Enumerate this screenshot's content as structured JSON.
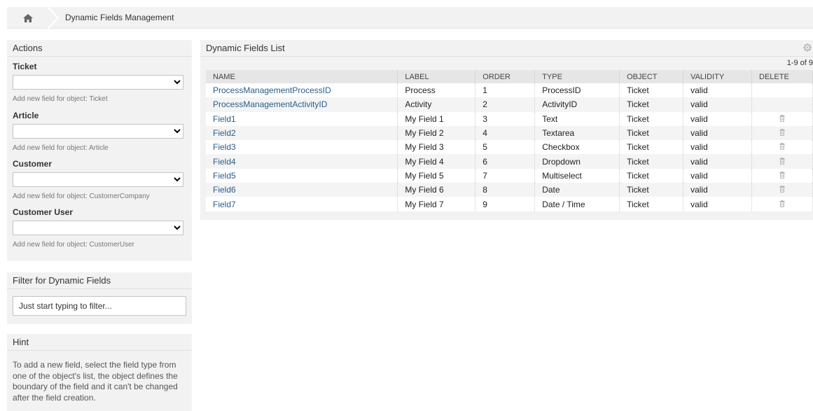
{
  "breadcrumb": {
    "home_icon": "home-icon",
    "title": "Dynamic Fields Management"
  },
  "actions": {
    "title": "Actions",
    "groups": [
      {
        "title": "Ticket",
        "hint": "Add new field for object: Ticket"
      },
      {
        "title": "Article",
        "hint": "Add new field for object: Article"
      },
      {
        "title": "Customer",
        "hint": "Add new field for object: CustomerCompany"
      },
      {
        "title": "Customer User",
        "hint": "Add new field for object: CustomerUser"
      }
    ]
  },
  "filter": {
    "title": "Filter for Dynamic Fields",
    "placeholder": "Just start typing to filter..."
  },
  "hint": {
    "title": "Hint",
    "text": "To add a new field, select the field type from one of the object's list, the object defines the boundary of the field and it can't be changed after the field creation."
  },
  "list": {
    "title": "Dynamic Fields List",
    "pager": "1-9 of 9",
    "settings_icon": "gear-icon",
    "columns": [
      "NAME",
      "LABEL",
      "ORDER",
      "TYPE",
      "OBJECT",
      "VALIDITY",
      "DELETE"
    ],
    "rows": [
      {
        "name": "ProcessManagementProcessID",
        "label": "Process",
        "order": "1",
        "type": "ProcessID",
        "object": "Ticket",
        "validity": "valid",
        "deletable": false
      },
      {
        "name": "ProcessManagementActivityID",
        "label": "Activity",
        "order": "2",
        "type": "ActivityID",
        "object": "Ticket",
        "validity": "valid",
        "deletable": false
      },
      {
        "name": "Field1",
        "label": "My Field 1",
        "order": "3",
        "type": "Text",
        "object": "Ticket",
        "validity": "valid",
        "deletable": true
      },
      {
        "name": "Field2",
        "label": "My Field 2",
        "order": "4",
        "type": "Textarea",
        "object": "Ticket",
        "validity": "valid",
        "deletable": true
      },
      {
        "name": "Field3",
        "label": "My Field 3",
        "order": "5",
        "type": "Checkbox",
        "object": "Ticket",
        "validity": "valid",
        "deletable": true
      },
      {
        "name": "Field4",
        "label": "My Field 4",
        "order": "6",
        "type": "Dropdown",
        "object": "Ticket",
        "validity": "valid",
        "deletable": true
      },
      {
        "name": "Field5",
        "label": "My Field 5",
        "order": "7",
        "type": "Multiselect",
        "object": "Ticket",
        "validity": "valid",
        "deletable": true
      },
      {
        "name": "Field6",
        "label": "My Field 6",
        "order": "8",
        "type": "Date",
        "object": "Ticket",
        "validity": "valid",
        "deletable": true
      },
      {
        "name": "Field7",
        "label": "My Field 7",
        "order": "9",
        "type": "Date / Time",
        "object": "Ticket",
        "validity": "valid",
        "deletable": true
      }
    ]
  },
  "colors": {
    "link": "#2b5c8a",
    "panel_bg": "#f2f2f2",
    "header_bg": "#e6e6e6"
  }
}
